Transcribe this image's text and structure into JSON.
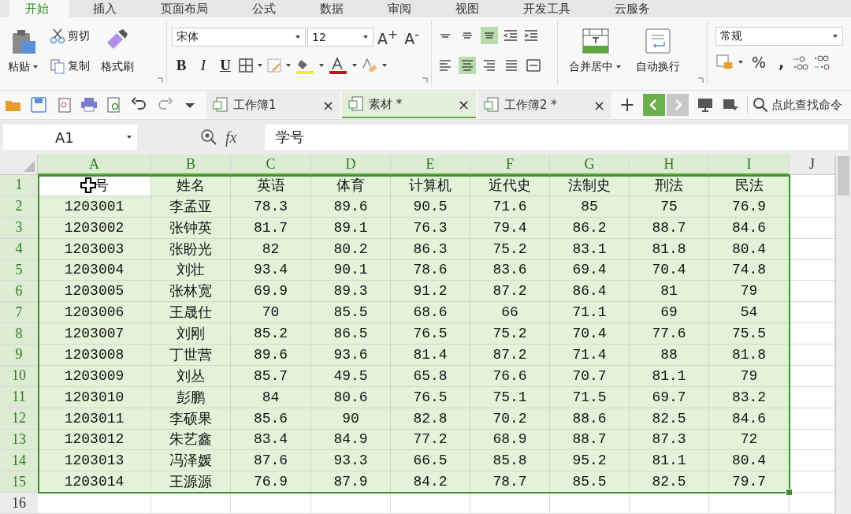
{
  "menu_tabs": [
    {
      "label": "开始",
      "selected": true
    },
    {
      "label": "插入",
      "selected": false
    },
    {
      "label": "页面布局",
      "selected": false
    },
    {
      "label": "公式",
      "selected": false
    },
    {
      "label": "数据",
      "selected": false
    },
    {
      "label": "审阅",
      "selected": false
    },
    {
      "label": "视图",
      "selected": false
    },
    {
      "label": "开发工具",
      "selected": false
    },
    {
      "label": "云服务",
      "selected": false
    }
  ],
  "ribbon": {
    "paste": "粘贴",
    "cut": "剪切",
    "copy": "复制",
    "format_painter": "格式刷",
    "font_name": "宋体",
    "font_size": "12",
    "grow_font": "A$^{+}$",
    "shrink_font": "A$^{-}$",
    "bold": "B",
    "italic": "I",
    "underline": "U",
    "align_vertical": [
      {
        "kind": "top",
        "selected": false
      },
      {
        "kind": "middle",
        "selected": false
      },
      {
        "kind": "bottom",
        "selected": true
      }
    ],
    "align_horizontal": [
      {
        "kind": "left",
        "selected": false
      },
      {
        "kind": "center",
        "selected": true
      },
      {
        "kind": "right",
        "selected": false
      },
      {
        "kind": "justify",
        "selected": false
      },
      {
        "kind": "distributed",
        "selected": false
      }
    ],
    "merge": "合并居中",
    "wrap": "自动换行",
    "number_format": "常规",
    "percent": "%",
    "comma": ","
  },
  "doc_tabs": [
    {
      "title": "工作簿1",
      "close": "×",
      "selected": false
    },
    {
      "title": "素材 *",
      "close": "×",
      "selected": true
    },
    {
      "title": "工作簿2 *",
      "close": "×",
      "selected": false
    }
  ],
  "new_tab": "+",
  "search": {
    "placeholder": "点此查找命令"
  },
  "formula_bar": {
    "name_box": "A1",
    "fx": "fx",
    "value": "学号"
  },
  "sheet": {
    "columns": [
      {
        "label": "A",
        "selected": true
      },
      {
        "label": "B",
        "selected": true
      },
      {
        "label": "C",
        "selected": true
      },
      {
        "label": "D",
        "selected": true
      },
      {
        "label": "E",
        "selected": true
      },
      {
        "label": "F",
        "selected": true
      },
      {
        "label": "G",
        "selected": true
      },
      {
        "label": "H",
        "selected": true
      },
      {
        "label": "I",
        "selected": true
      },
      {
        "label": "J",
        "selected": false
      }
    ],
    "rows": [
      {
        "number": "1",
        "selected": true,
        "cells": [
          {
            "text": "号",
            "active": true,
            "cursor": true
          },
          "姓名",
          "英语",
          "体育",
          "计算机",
          "近代史",
          "法制史",
          "刑法",
          "民法"
        ]
      },
      {
        "number": "2",
        "selected": true,
        "cells": [
          "1203001",
          "李孟亚",
          "78.3",
          "89.6",
          "90.5",
          "71.6",
          "85",
          "75",
          "76.9"
        ]
      },
      {
        "number": "3",
        "selected": true,
        "cells": [
          "1203002",
          "张钟英",
          "81.7",
          "89.1",
          "76.3",
          "79.4",
          "86.2",
          "88.7",
          "84.6"
        ]
      },
      {
        "number": "4",
        "selected": true,
        "cells": [
          "1203003",
          "张盼光",
          "82",
          "80.2",
          "86.3",
          "75.2",
          "83.1",
          "81.8",
          "80.4"
        ]
      },
      {
        "number": "5",
        "selected": true,
        "cells": [
          "1203004",
          "刘壮",
          "93.4",
          "90.1",
          "78.6",
          "83.6",
          "69.4",
          "70.4",
          "74.8"
        ]
      },
      {
        "number": "6",
        "selected": true,
        "cells": [
          "1203005",
          "张林宽",
          "69.9",
          "89.3",
          "91.2",
          "87.2",
          "86.4",
          "81",
          "79"
        ]
      },
      {
        "number": "7",
        "selected": true,
        "cells": [
          "1203006",
          "王晟仕",
          "70",
          "85.5",
          "68.6",
          "66",
          "71.1",
          "69",
          "54"
        ]
      },
      {
        "number": "8",
        "selected": true,
        "cells": [
          "1203007",
          "刘刚",
          "85.2",
          "86.5",
          "76.5",
          "75.2",
          "70.4",
          "77.6",
          "75.5"
        ]
      },
      {
        "number": "9",
        "selected": true,
        "cells": [
          "1203008",
          "丁世营",
          "89.6",
          "93.6",
          "81.4",
          "87.2",
          "71.4",
          "88",
          "81.8"
        ]
      },
      {
        "number": "10",
        "selected": true,
        "cells": [
          "1203009",
          "刘丛",
          "85.7",
          "49.5",
          "65.8",
          "76.6",
          "70.7",
          "81.1",
          "79"
        ]
      },
      {
        "number": "11",
        "selected": true,
        "cells": [
          "1203010",
          "彭鹏",
          "84",
          "80.6",
          "76.5",
          "75.1",
          "71.5",
          "69.7",
          "83.2"
        ]
      },
      {
        "number": "12",
        "selected": true,
        "cells": [
          "1203011",
          "李硕果",
          "85.6",
          "90",
          "82.8",
          "70.2",
          "88.6",
          "82.5",
          "84.6"
        ]
      },
      {
        "number": "13",
        "selected": true,
        "cells": [
          "1203012",
          "朱艺鑫",
          "83.4",
          "84.9",
          "77.2",
          "68.9",
          "88.7",
          "87.3",
          "72"
        ]
      },
      {
        "number": "14",
        "selected": true,
        "cells": [
          "1203013",
          "冯泽媛",
          "87.6",
          "93.3",
          "66.5",
          "85.8",
          "95.2",
          "81.1",
          "80.4"
        ]
      },
      {
        "number": "15",
        "selected": true,
        "cells": [
          "1203014",
          "王源源",
          "76.9",
          "87.9",
          "84.2",
          "78.7",
          "85.5",
          "82.5",
          "79.7"
        ]
      },
      {
        "number": "16",
        "selected": false,
        "cells": []
      }
    ]
  }
}
